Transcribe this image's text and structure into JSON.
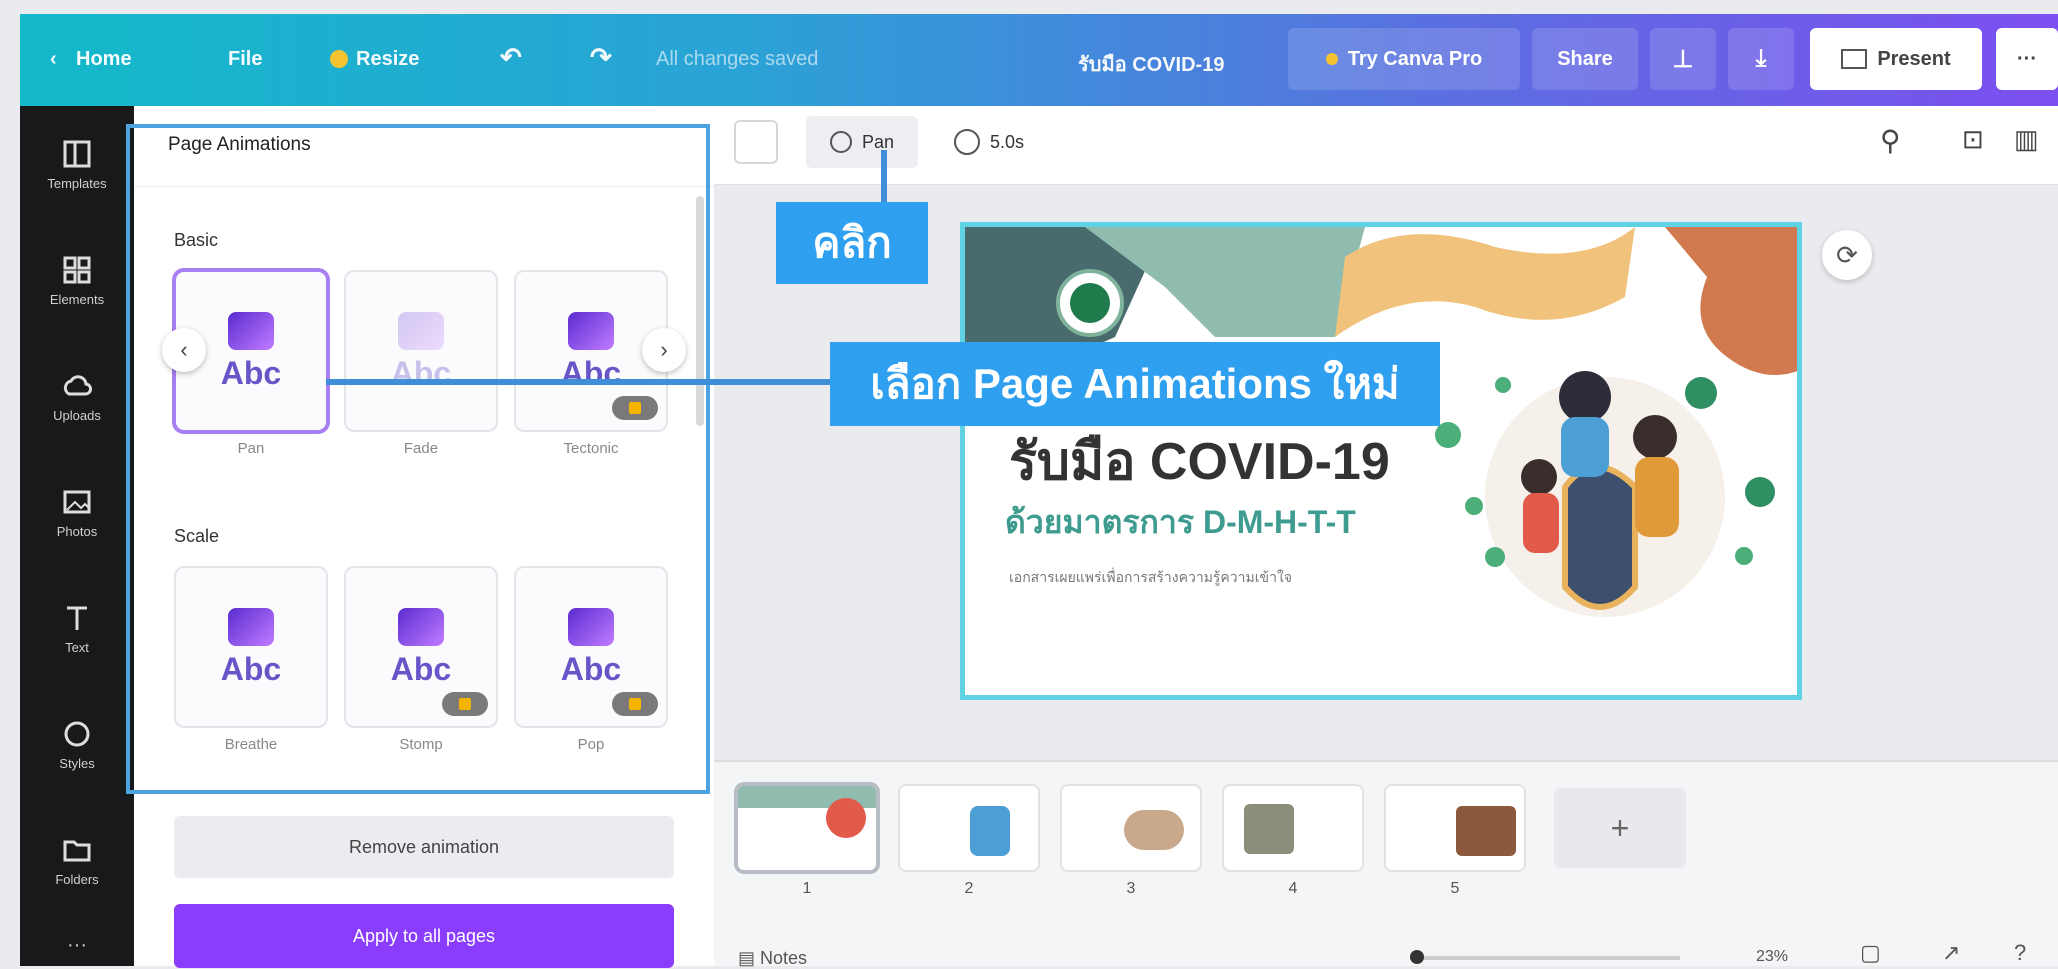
{
  "topbar": {
    "home": "Home",
    "file": "File",
    "resize": "Resize",
    "status": "All changes saved",
    "doc_title": "รับมือ COVID-19",
    "try_pro": "Try Canva Pro",
    "share": "Share",
    "present": "Present",
    "more": "···"
  },
  "rail": {
    "items": [
      "Templates",
      "Elements",
      "Uploads",
      "Photos",
      "Text",
      "Styles",
      "Folders"
    ],
    "more": "···"
  },
  "panel": {
    "title": "Page Animations",
    "basic_heading": "Basic",
    "scale_heading": "Scale",
    "basic": [
      "Pan",
      "Fade",
      "Tectonic"
    ],
    "scale": [
      "Breathe",
      "Stomp",
      "Pop"
    ],
    "card_text": "Abc",
    "remove": "Remove animation",
    "apply": "Apply to all pages"
  },
  "toolbar2": {
    "animate": "Pan",
    "duration": "5.0s"
  },
  "callouts": {
    "click": "คลิก",
    "choose": "เลือก Page Animations ใหม่"
  },
  "slide": {
    "title": "รับมือ COVID-19",
    "subtitle": "ด้วยมาตรการ D-M-H-T-T",
    "caption": "เอกสารเผยแพร่เพื่อการสร้างความรู้ความเข้าใจ"
  },
  "pages": {
    "numbers": [
      "1",
      "2",
      "3",
      "4",
      "5"
    ],
    "add": "+"
  },
  "bottom": {
    "notes": "Notes",
    "zoom": "23%"
  },
  "colors": {
    "accent": "#8b3dff",
    "callout": "#2f9ff0",
    "slide_border": "#5fd3e3",
    "title_text": "#333333",
    "subtitle_text": "#3d9b8f"
  }
}
